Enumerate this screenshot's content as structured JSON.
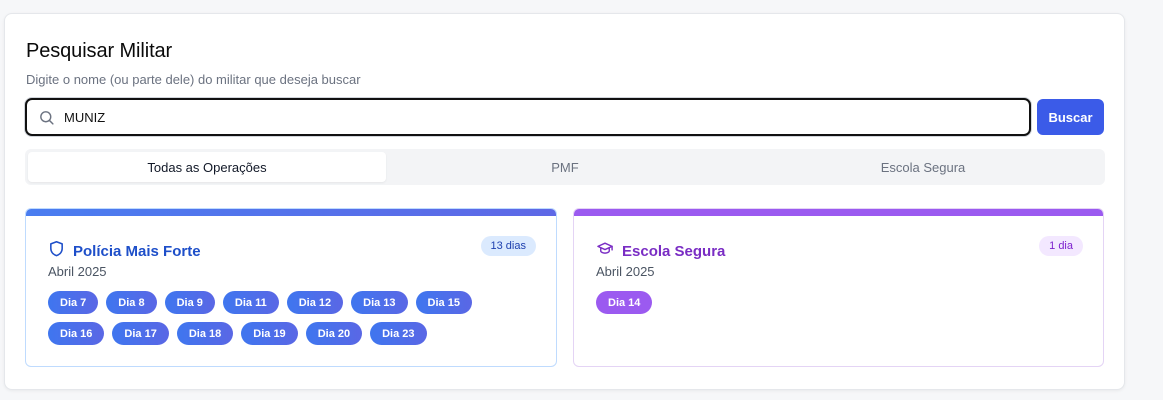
{
  "search": {
    "title": "Pesquisar Militar",
    "subtitle": "Digite o nome (ou parte dele) do militar que deseja buscar",
    "value": "MUNIZ",
    "button_label": "Buscar"
  },
  "tabs": [
    {
      "label": "Todas as Operações",
      "active": true
    },
    {
      "label": "PMF",
      "active": false
    },
    {
      "label": "Escola Segura",
      "active": false
    }
  ],
  "cards": [
    {
      "title": "Polícia Mais Forte",
      "subtitle": "Abril 2025",
      "badge": "13 dias",
      "icon": "shield-icon",
      "color": "#1e4fc9",
      "days": [
        "Dia 7",
        "Dia 8",
        "Dia 9",
        "Dia 11",
        "Dia 12",
        "Dia 13",
        "Dia 15",
        "Dia 16",
        "Dia 17",
        "Dia 18",
        "Dia 19",
        "Dia 20",
        "Dia 23"
      ]
    },
    {
      "title": "Escola Segura",
      "subtitle": "Abril 2025",
      "badge": "1 dia",
      "icon": "graduation-cap-icon",
      "color": "#7a2dc4",
      "days": [
        "Dia 14"
      ]
    }
  ]
}
